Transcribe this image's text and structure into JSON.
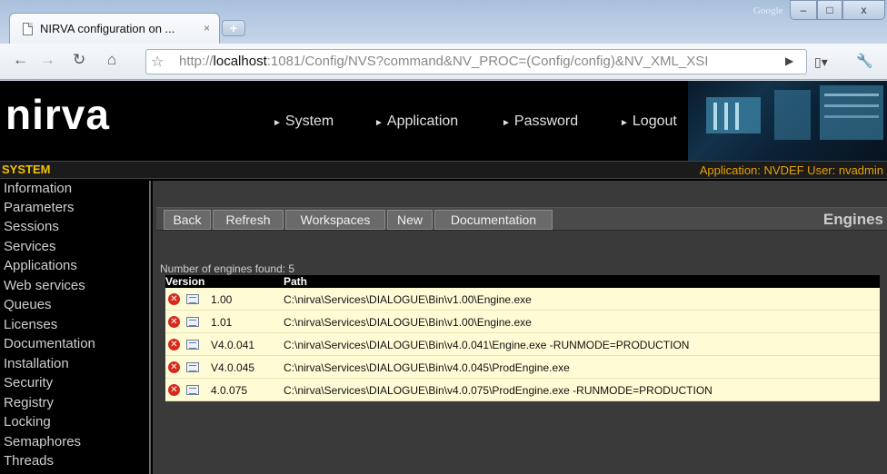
{
  "browser": {
    "tab_title": "NIRVA configuration on ...",
    "tab_close": "×",
    "new_tab": "+",
    "google_label": "Google",
    "url_prefix": "http://",
    "url_host": "localhost",
    "url_rest": ":1081/Config/NVS?command&NV_PROC=(Config/config)&NV_XML_XSI",
    "controls": {
      "minimize": "–",
      "maximize": "□",
      "close": "x"
    }
  },
  "app": {
    "logo": "nirva",
    "nav": [
      {
        "label": "System"
      },
      {
        "label": "Application"
      },
      {
        "label": "Password"
      },
      {
        "label": "Logout"
      }
    ],
    "section": "SYSTEM",
    "app_info": "Application: NVDEF   User: nvadmin"
  },
  "sidebar": {
    "items": [
      {
        "label": "Information"
      },
      {
        "label": "Parameters"
      },
      {
        "label": "Sessions"
      },
      {
        "label": "Services"
      },
      {
        "label": "Applications"
      },
      {
        "label": "Web services"
      },
      {
        "label": "Queues"
      },
      {
        "label": "Licenses"
      },
      {
        "label": "Documentation"
      },
      {
        "label": "Installation"
      },
      {
        "label": "Security"
      },
      {
        "label": "Registry"
      },
      {
        "label": "Locking"
      },
      {
        "label": "Semaphores"
      },
      {
        "label": "Threads"
      }
    ]
  },
  "content": {
    "buttons": [
      {
        "label": "Back"
      },
      {
        "label": "Refresh"
      },
      {
        "label": "Workspaces"
      },
      {
        "label": "New"
      },
      {
        "label": "Documentation"
      }
    ],
    "heading": "Engines",
    "count_text": "Number of engines found: 5",
    "columns": {
      "version": "Version",
      "path": "Path"
    },
    "rows": [
      {
        "version": "1.00",
        "path": "C:\\nirva\\Services\\DIALOGUE\\Bin\\v1.00\\Engine.exe"
      },
      {
        "version": "1.01",
        "path": "C:\\nirva\\Services\\DIALOGUE\\Bin\\v1.00\\Engine.exe"
      },
      {
        "version": "V4.0.041",
        "path": "C:\\nirva\\Services\\DIALOGUE\\Bin\\v4.0.041\\Engine.exe -RUNMODE=PRODUCTION"
      },
      {
        "version": "V4.0.045",
        "path": "C:\\nirva\\Services\\DIALOGUE\\Bin\\v4.0.045\\ProdEngine.exe"
      },
      {
        "version": "4.0.075",
        "path": "C:\\nirva\\Services\\DIALOGUE\\Bin\\v4.0.075\\ProdEngine.exe -RUNMODE=PRODUCTION"
      }
    ]
  },
  "colors": {
    "accent_section": "#f2c200",
    "app_info": "#e6a300",
    "row_background": "#fffcd5",
    "delete_icon": "#d62a1e"
  }
}
